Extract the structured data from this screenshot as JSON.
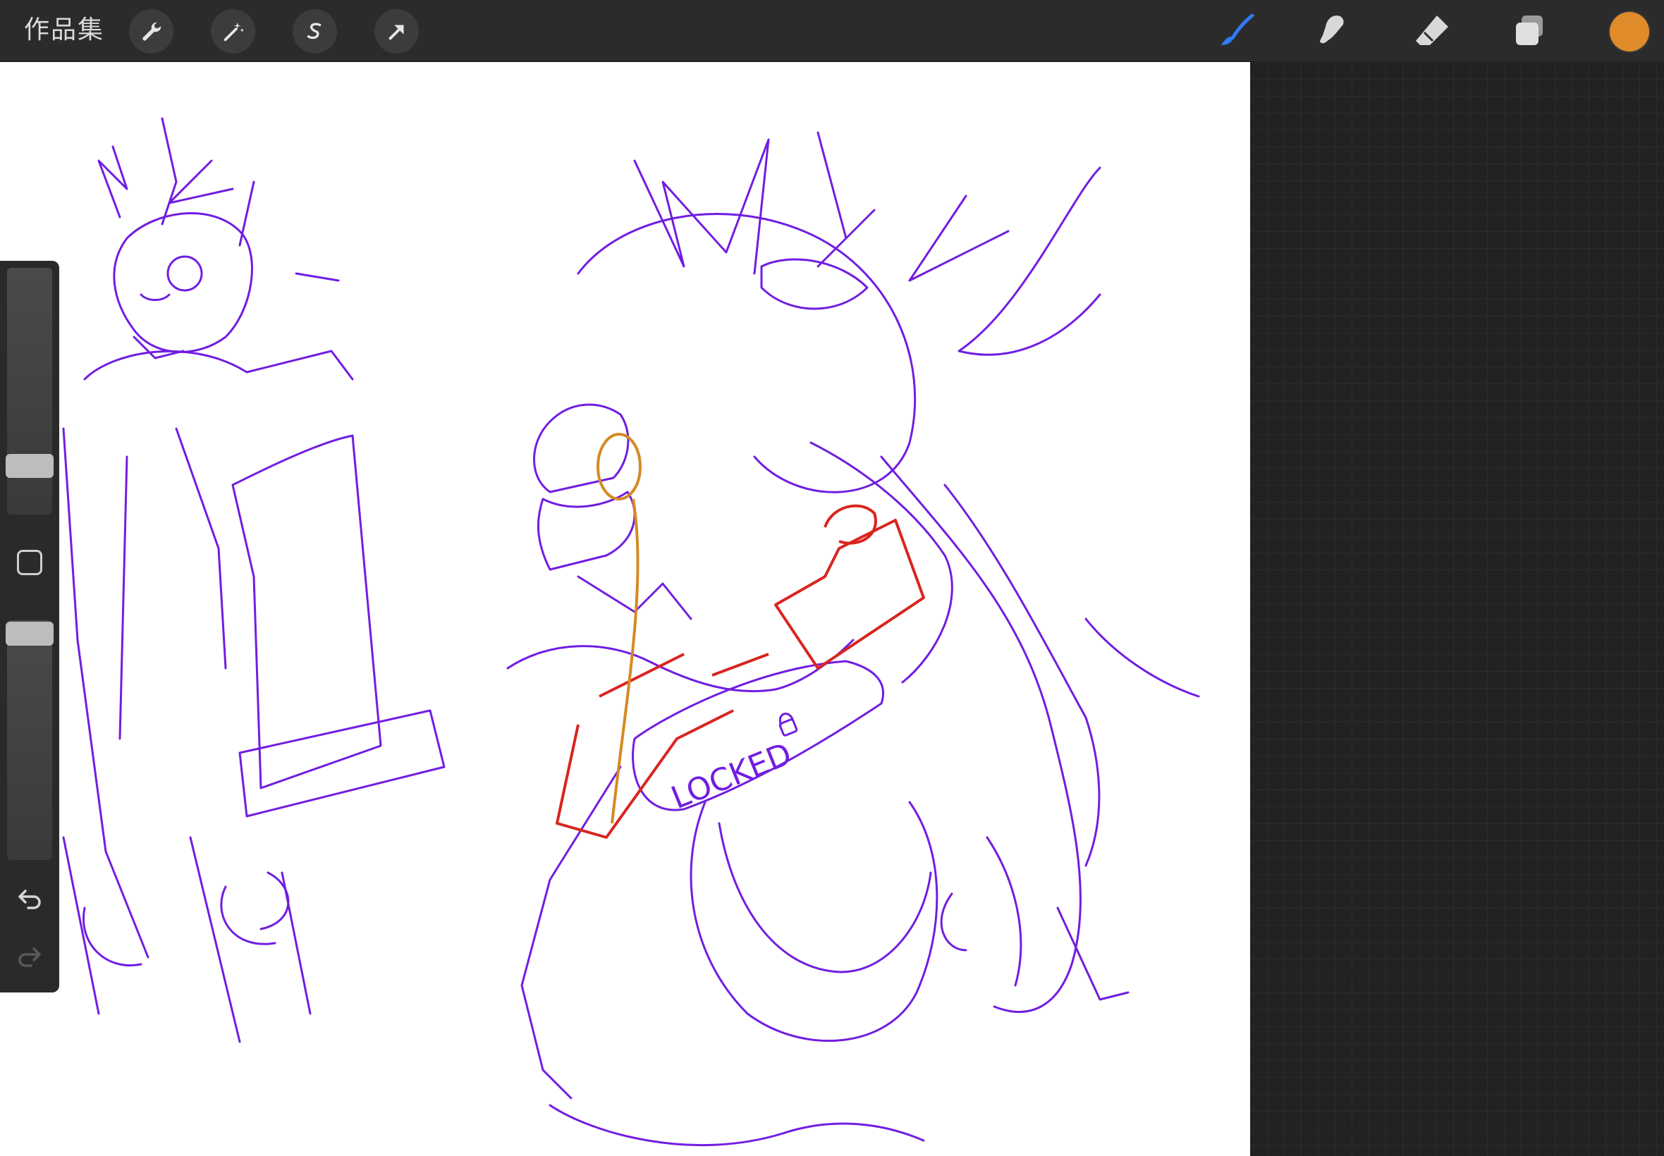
{
  "topbar": {
    "gallery_label": "作品集",
    "left_tools": [
      {
        "icon": "wrench-icon"
      },
      {
        "icon": "magic-wand-icon"
      },
      {
        "icon": "selection-s-icon"
      },
      {
        "icon": "arrow-transform-icon"
      }
    ],
    "right_tools": [
      {
        "icon": "brush-icon",
        "active": true
      },
      {
        "icon": "smudge-icon"
      },
      {
        "icon": "eraser-icon"
      },
      {
        "icon": "layers-icon"
      }
    ],
    "current_color": "#e08b2a",
    "active_color": "#2f7bf6"
  },
  "sidebar": {
    "brush_size": 0.68,
    "brush_opacity": 0.05,
    "modify_button": "square-icon",
    "undo": "undo-icon",
    "redo": "redo-icon"
  },
  "canvas": {
    "annotation_text": "LOCKED",
    "stroke_colors": [
      "#6a11e0",
      "#d9251f",
      "#d48a24"
    ]
  }
}
